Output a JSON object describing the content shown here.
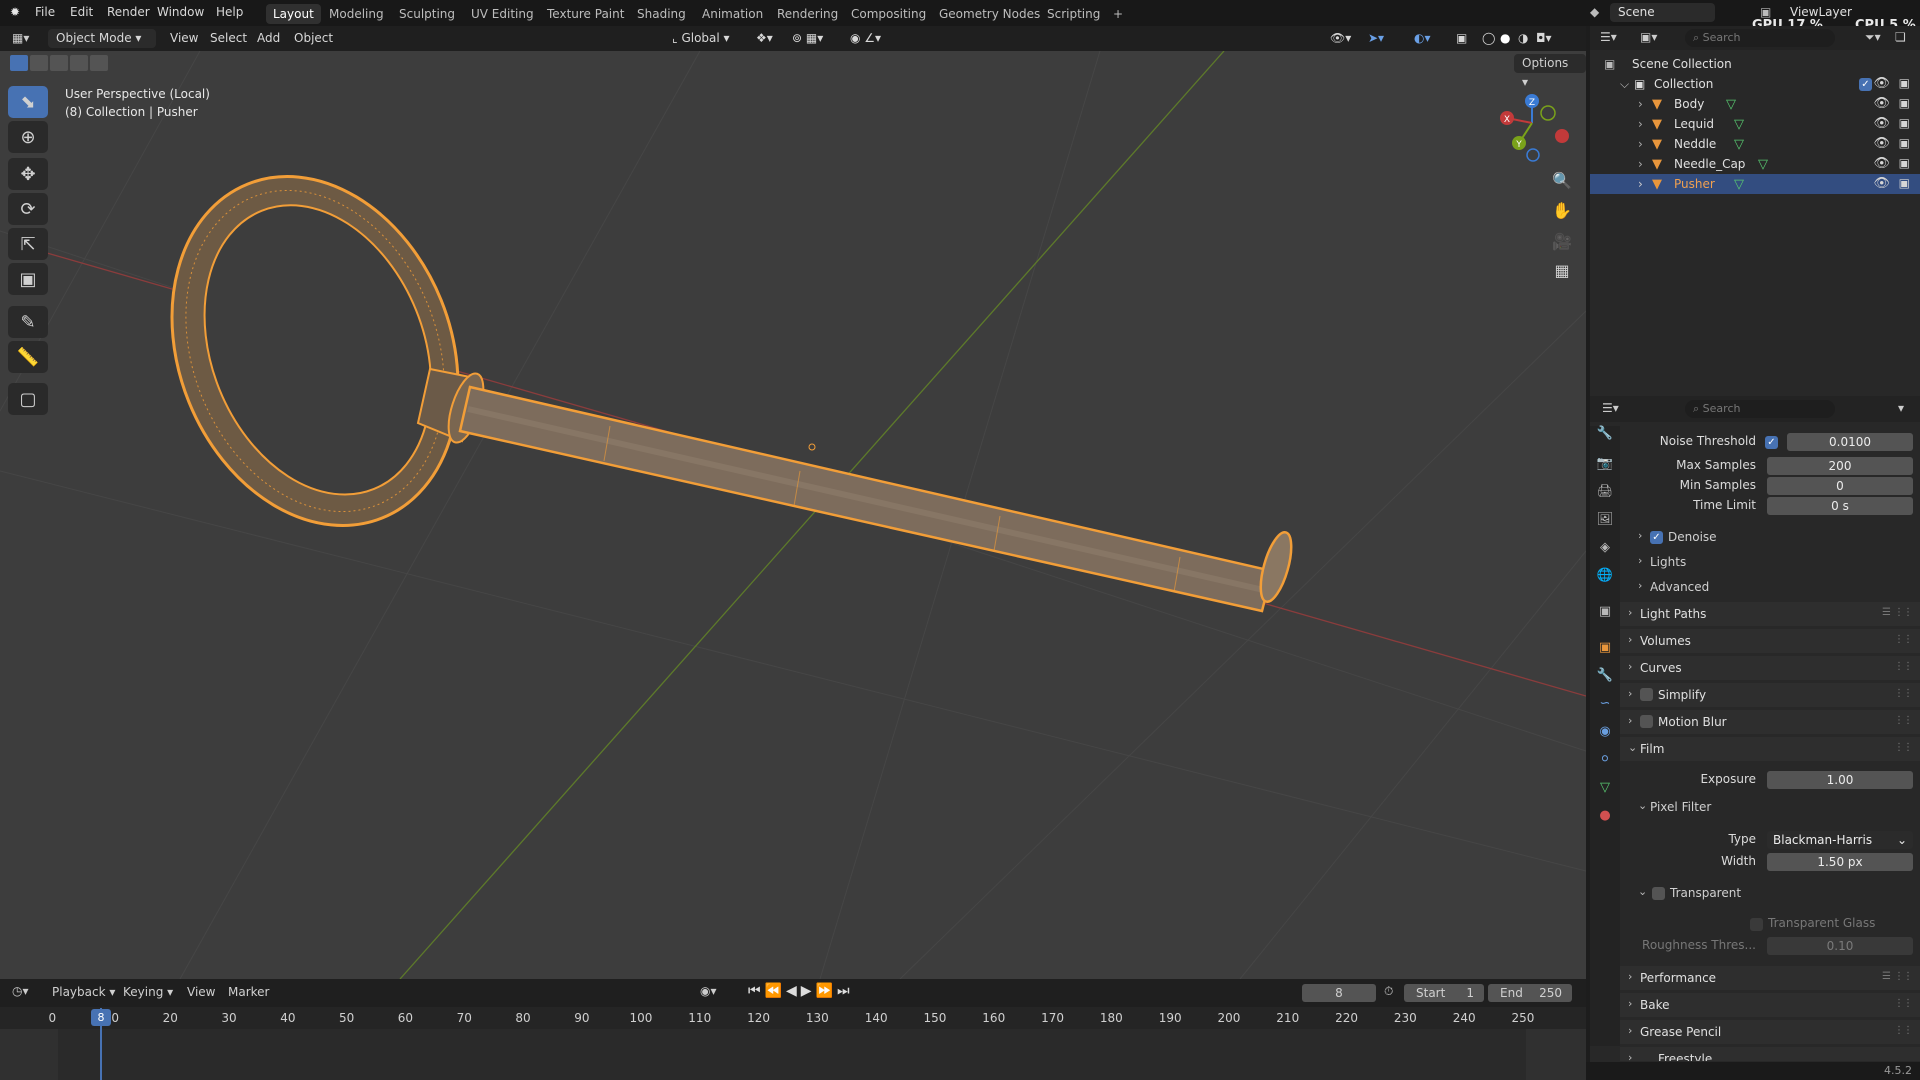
{
  "topbar": {
    "menus": [
      "File",
      "Edit",
      "Render",
      "Window",
      "Help"
    ],
    "workspaces": [
      "Layout",
      "Modeling",
      "Sculpting",
      "UV Editing",
      "Texture Paint",
      "Shading",
      "Animation",
      "Rendering",
      "Compositing",
      "Geometry Nodes",
      "Scripting"
    ],
    "active_workspace": "Layout",
    "add_tab": "+",
    "scene": "Scene",
    "view_layer": "ViewLayer",
    "gpu": "GPU 17 %",
    "cpu": "CPU 5 %"
  },
  "viewport_header": {
    "mode": "Object Mode",
    "menus": [
      "View",
      "Select",
      "Add",
      "Object"
    ],
    "orientation": "Global",
    "options": "Options"
  },
  "viewport": {
    "perspective": "User Perspective (Local)",
    "context": "(8) Collection | Pusher",
    "gizmo_axes": [
      "X",
      "Y",
      "Z"
    ],
    "colors": {
      "x_axis": "#c23a3a",
      "y_axis": "#7aa21a",
      "z_axis": "#3a7bd5",
      "selection": "#f29e38",
      "background": "#3d3d3d"
    }
  },
  "outliner": {
    "search_placeholder": "Search",
    "root": "Scene Collection",
    "collection": "Collection",
    "objects": [
      "Body",
      "Lequid",
      "Neddle",
      "Needle_Cap",
      "Pusher"
    ],
    "selected": "Pusher"
  },
  "properties": {
    "search_placeholder": "Search",
    "noise_threshold_label": "Noise Threshold",
    "noise_threshold": "0.0100",
    "max_samples_label": "Max Samples",
    "max_samples": "200",
    "min_samples_label": "Min Samples",
    "min_samples": "0",
    "time_limit_label": "Time Limit",
    "time_limit": "0 s",
    "denoise": "Denoise",
    "lights": "Lights",
    "advanced": "Advanced",
    "light_paths": "Light Paths",
    "volumes": "Volumes",
    "curves": "Curves",
    "simplify": "Simplify",
    "motion_blur": "Motion Blur",
    "film": "Film",
    "exposure_label": "Exposure",
    "exposure": "1.00",
    "pixel_filter": "Pixel Filter",
    "type_label": "Type",
    "type_value": "Blackman-Harris",
    "width_label": "Width",
    "width_value": "1.50 px",
    "transparent": "Transparent",
    "transparent_glass": "Transparent Glass",
    "roughness_label": "Roughness Thres...",
    "roughness_value": "0.10",
    "performance": "Performance",
    "bake": "Bake",
    "grease_pencil": "Grease Pencil",
    "freestyle": "Freestyle"
  },
  "timeline": {
    "menus": [
      "Playback",
      "Keying",
      "View",
      "Marker"
    ],
    "current_frame": "8",
    "start_label": "Start",
    "start": "1",
    "end_label": "End",
    "end": "250",
    "ruler_ticks": [
      "0",
      "10",
      "20",
      "30",
      "40",
      "50",
      "60",
      "70",
      "80",
      "90",
      "100",
      "110",
      "120",
      "130",
      "140",
      "150",
      "160",
      "170",
      "180",
      "190",
      "200",
      "210",
      "220",
      "230",
      "240",
      "250"
    ]
  },
  "status": {
    "version": "4.5.2"
  }
}
